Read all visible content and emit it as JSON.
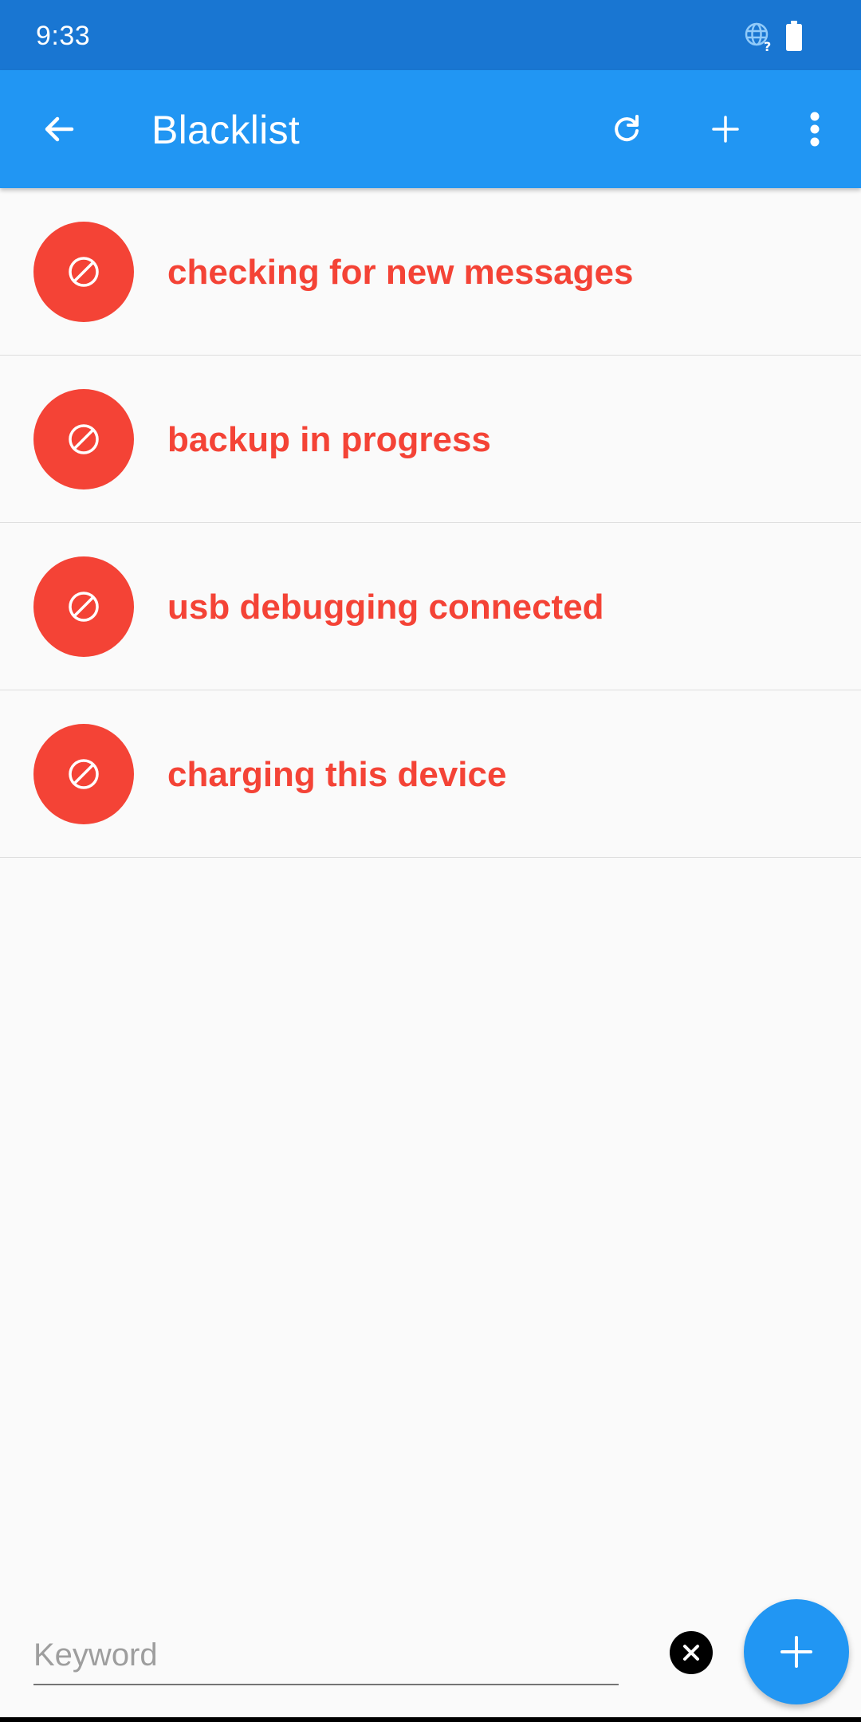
{
  "status_bar": {
    "time": "9:33",
    "icons": [
      "globe-question-icon",
      "battery-icon"
    ]
  },
  "app_bar": {
    "title": "Blacklist",
    "actions": [
      "arrow-left-icon",
      "refresh-icon",
      "plus-icon",
      "more-vert-icon"
    ]
  },
  "blacklist": {
    "items": [
      {
        "label": "checking for new messages",
        "icon": "block-icon"
      },
      {
        "label": "backup in progress",
        "icon": "block-icon"
      },
      {
        "label": "usb debugging connected",
        "icon": "block-icon"
      },
      {
        "label": "charging this device",
        "icon": "block-icon"
      }
    ]
  },
  "input_bar": {
    "keyword_placeholder": "Keyword",
    "keyword_value": "",
    "clear_icon": "close-circle-icon",
    "fab_icon": "plus-icon"
  },
  "colors": {
    "status_bar": "#1976d2",
    "app_bar": "#2196f3",
    "accent_red": "#f44336",
    "background": "#fafafa"
  }
}
